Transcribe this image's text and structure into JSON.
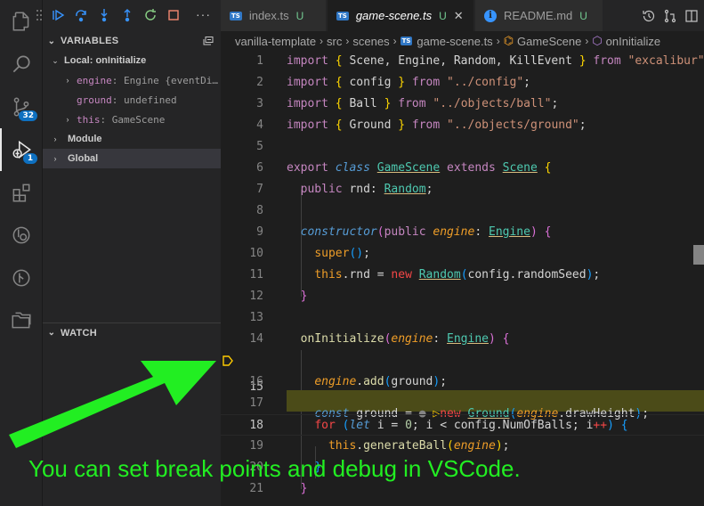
{
  "activity_bar": {
    "source_control_badge": "32",
    "debug_badge": "1"
  },
  "debug_toolbar": {
    "buttons": [
      "continue",
      "step-over",
      "step-into",
      "step-out",
      "restart",
      "stop"
    ],
    "more": "···"
  },
  "sidebar": {
    "variables_header": "VARIABLES",
    "local_scope": "Local: onInitialize",
    "engine_name": "engine",
    "engine_value": "Engine {eventDi…",
    "ground_name": "ground",
    "ground_value": "undefined",
    "this_name": "this",
    "this_value": "GameScene",
    "module_scope": "Module",
    "global_scope": "Global",
    "watch_header": "WATCH"
  },
  "tabs": [
    {
      "label": "index.ts",
      "status": "U",
      "icon": "TS"
    },
    {
      "label": "game-scene.ts",
      "status": "U",
      "icon": "TS"
    },
    {
      "label": "README.md",
      "status": "U",
      "icon": "i"
    }
  ],
  "breadcrumb": {
    "p1": "vanilla-template",
    "p2": "src",
    "p3": "scenes",
    "p4": "game-scene.ts",
    "p5": "GameScene",
    "p6": "onInitialize"
  },
  "line_numbers": [
    "1",
    "2",
    "3",
    "4",
    "5",
    "6",
    "7",
    "8",
    "9",
    "10",
    "11",
    "12",
    "13",
    "14",
    "15",
    "16",
    "17",
    "18",
    "19",
    "20",
    "21"
  ],
  "annotation": "You can set break points and debug in VSCode."
}
